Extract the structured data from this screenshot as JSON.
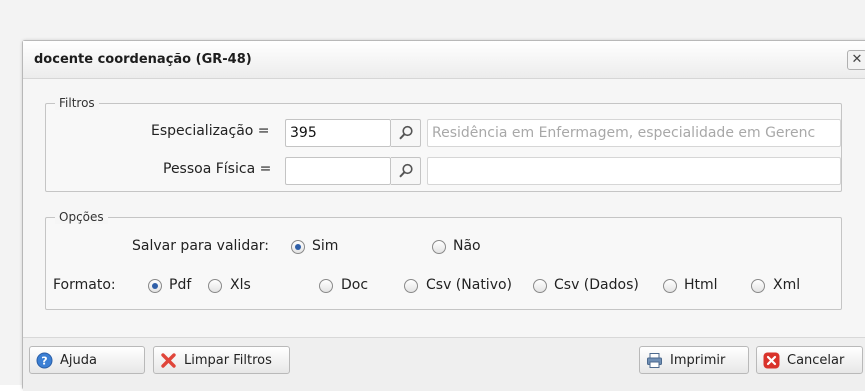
{
  "dialog": {
    "title": "docente coordenação (GR-48)",
    "close_glyph": "✕"
  },
  "filtros": {
    "legend": "Filtros",
    "especializacao": {
      "label": "Especialização =",
      "value": "395",
      "description": "Residência em Enfermagem, especialidade em Gerenc"
    },
    "pessoa_fisica": {
      "label": "Pessoa Física =",
      "value": "",
      "description": ""
    },
    "search_icon": "magnifier-icon"
  },
  "opcoes": {
    "legend": "Opções",
    "salvar": {
      "label": "Salvar para validar:",
      "options": [
        "Sim",
        "Não"
      ],
      "selected": "Sim"
    },
    "formato": {
      "label": "Formato:",
      "options": [
        "Pdf",
        "Xls",
        "Doc",
        "Csv (Nativo)",
        "Csv (Dados)",
        "Html",
        "Xml"
      ],
      "selected": "Pdf"
    }
  },
  "footer": {
    "ajuda": "Ajuda",
    "limpar": "Limpar Filtros",
    "imprimir": "Imprimir",
    "cancelar": "Cancelar"
  },
  "colors": {
    "radio_selected": "#2f5fa8",
    "cancel_icon": "#d9332b",
    "clear_icon": "#e0453a",
    "help_icon": "#3b7fd4"
  }
}
